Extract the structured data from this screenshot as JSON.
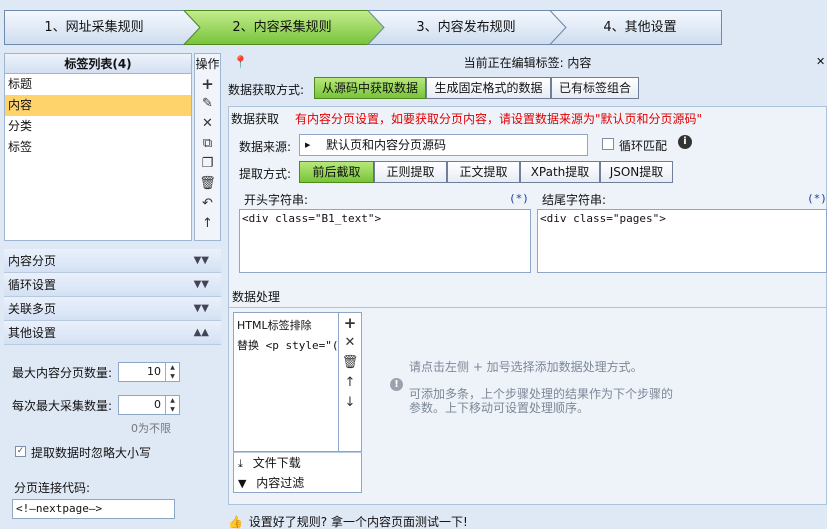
{
  "wizard": {
    "steps": [
      {
        "label": "1、网址采集规则"
      },
      {
        "label": "2、内容采集规则"
      },
      {
        "label": "3、内容发布规则"
      },
      {
        "label": "4、其他设置"
      }
    ]
  },
  "tag_list": {
    "header": "标签列表(4)",
    "items": [
      "标题",
      "内容",
      "分类",
      "标签"
    ],
    "selected_index": 1
  },
  "ops": {
    "title": "操作"
  },
  "accordion": {
    "items": [
      "内容分页",
      "循环设置",
      "关联多页",
      "其他设置"
    ]
  },
  "other_settings": {
    "max_pages_label": "最大内容分页数量:",
    "max_pages_value": "10",
    "max_collect_label": "每次最大采集数量:",
    "max_collect_value": "0",
    "max_collect_hint": "0为不限",
    "ignore_case_label": "提取数据时忽略大小写",
    "page_join_label": "分页连接代码:",
    "page_join_value": "<!—nextpage—>"
  },
  "editor": {
    "title": "当前正在编辑标签: 内容",
    "acquire_label": "数据获取方式:",
    "acquire_options": [
      "从源码中获取数据",
      "生成固定格式的数据",
      "已有标签组合"
    ],
    "acquire_section_title": "数据获取",
    "acquire_notice": "有内容分页设置，如要获取分页内容，请设置数据来源为\"默认页和分页源码\"",
    "source_label": "数据来源:",
    "source_value": "默认页和内容分页源码",
    "loop_match_label": "循环匹配",
    "extract_label": "提取方式:",
    "extract_options": [
      "前后截取",
      "正则提取",
      "正文提取",
      "XPath提取",
      "JSON提取"
    ],
    "start_label": "开头字符串:",
    "start_marker": "(*)",
    "start_value": "<div class=\"B1_text\">",
    "end_label": "结尾字符串:",
    "end_marker": "(*)",
    "end_value": "<div class=\"pages\">",
    "process_section_title": "数据处理",
    "process_items": [
      "HTML标签排除",
      "替换 <p style=\"(*"
    ],
    "process_actions": [
      "文件下载",
      "内容过滤"
    ],
    "hint_line1": "请点击左侧 + 加号选择添加数据处理方式。",
    "hint_line2": "可添加多条，上个步骤处理的结果作为下个步骤的",
    "hint_line3": "参数。上下移动可设置处理顺序。",
    "footer": "设置好了规则? 拿一个内容页面测试一下!"
  },
  "colors": {
    "accent_green": "#7cc63e",
    "notice_red": "#e00000",
    "selected_yellow": "#ffd36b"
  }
}
